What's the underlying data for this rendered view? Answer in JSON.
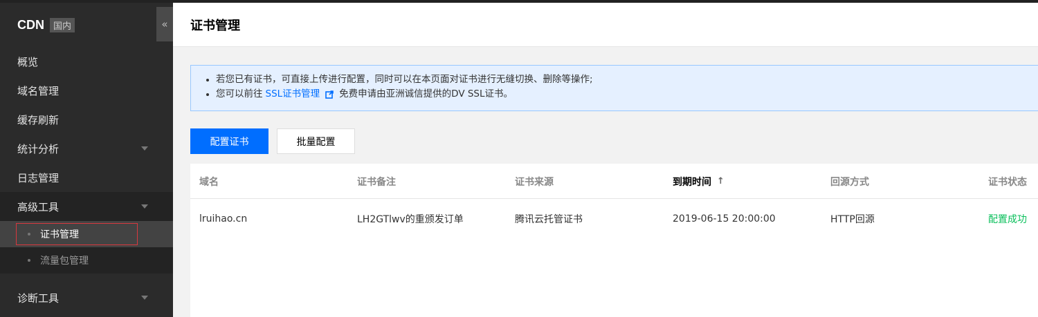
{
  "brand": {
    "name": "CDN",
    "region": "国内"
  },
  "sidebar": {
    "collapse_icon": "«",
    "items": [
      {
        "label": "概览"
      },
      {
        "label": "域名管理"
      },
      {
        "label": "缓存刷新"
      },
      {
        "label": "统计分析"
      },
      {
        "label": "日志管理"
      },
      {
        "label": "高级工具"
      },
      {
        "label": "诊断工具"
      }
    ],
    "sub_items": [
      {
        "label": "证书管理",
        "active": true
      },
      {
        "label": "流量包管理"
      }
    ]
  },
  "page": {
    "title": "证书管理"
  },
  "notice": {
    "line1": "若您已有证书，可直接上传进行配置，同时可以在本页面对证书进行无缝切换、删除等操作;",
    "line2_prefix": "您可以前往",
    "line2_link": "SSL证书管理",
    "line2_suffix": "免费申请由亚洲诚信提供的DV SSL证书。"
  },
  "toolbar": {
    "configure_label": "配置证书",
    "batch_label": "批量配置"
  },
  "table": {
    "columns": [
      "域名",
      "证书备注",
      "证书来源",
      "到期时间",
      "回源方式",
      "证书状态"
    ],
    "sort_icon": "↑",
    "rows": [
      {
        "domain": "lruihao.cn",
        "remark": "LH2GTlwv的重颁发订单",
        "source": "腾讯云托管证书",
        "expiry": "2019-06-15 20:00:00",
        "origin": "HTTP回源",
        "status": "配置成功"
      }
    ]
  },
  "colors": {
    "primary": "#006eff",
    "success": "#0abf5b",
    "sidebar_bg": "#2b2b2b",
    "highlight_border": "#d9383e"
  }
}
